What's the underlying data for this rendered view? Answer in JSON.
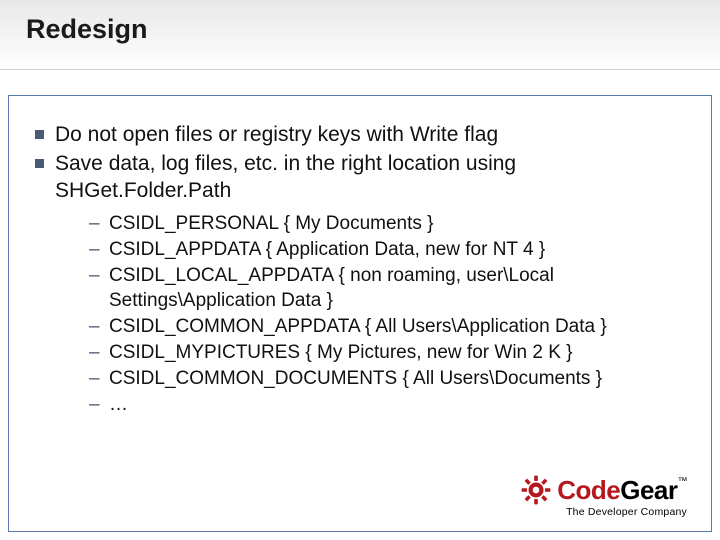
{
  "title": "Redesign",
  "bullets": [
    {
      "text": "Do not open files or registry keys with Write flag"
    },
    {
      "text": "Save data, log files, etc. in the right location using SHGet.Folder.Path",
      "sub": [
        "CSIDL_PERSONAL { My Documents }",
        "CSIDL_APPDATA { Application Data, new for NT 4 }",
        "CSIDL_LOCAL_APPDATA { non roaming, user\\Local Settings\\Application Data }",
        "CSIDL_COMMON_APPDATA { All Users\\Application Data }",
        "CSIDL_MYPICTURES { My Pictures, new for Win 2 K }",
        "CSIDL_COMMON_DOCUMENTS { All Users\\Documents }",
        "…"
      ]
    }
  ],
  "logo": {
    "part1": "Code",
    "part2": "Gear",
    "tm": "™",
    "tagline": "The Developer Company"
  }
}
